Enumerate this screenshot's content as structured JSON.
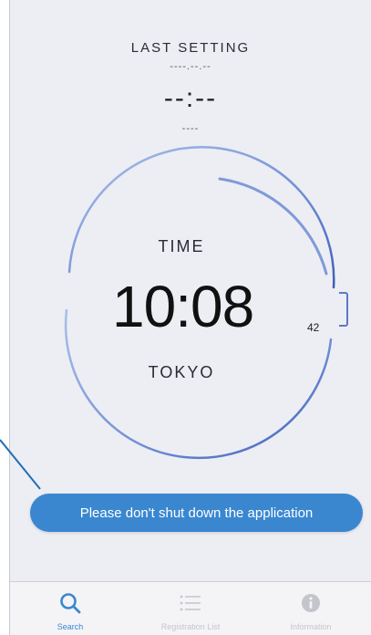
{
  "last_setting": {
    "title": "LAST SETTING",
    "date": "----.--.--",
    "time": "--:--",
    "city": "----"
  },
  "clock": {
    "label": "TIME",
    "time": "10:08",
    "seconds": "42",
    "city": "TOKYO"
  },
  "toast": {
    "message": "Please don't shut down the application"
  },
  "tabs": [
    {
      "label": "Search",
      "icon": "search-icon",
      "active": true
    },
    {
      "label": "Registration List",
      "icon": "list-icon",
      "active": false
    },
    {
      "label": "Information",
      "icon": "info-icon",
      "active": false
    }
  ],
  "colors": {
    "accent": "#3a87d0",
    "dial": "#5b79c6",
    "background": "#ededf4"
  }
}
